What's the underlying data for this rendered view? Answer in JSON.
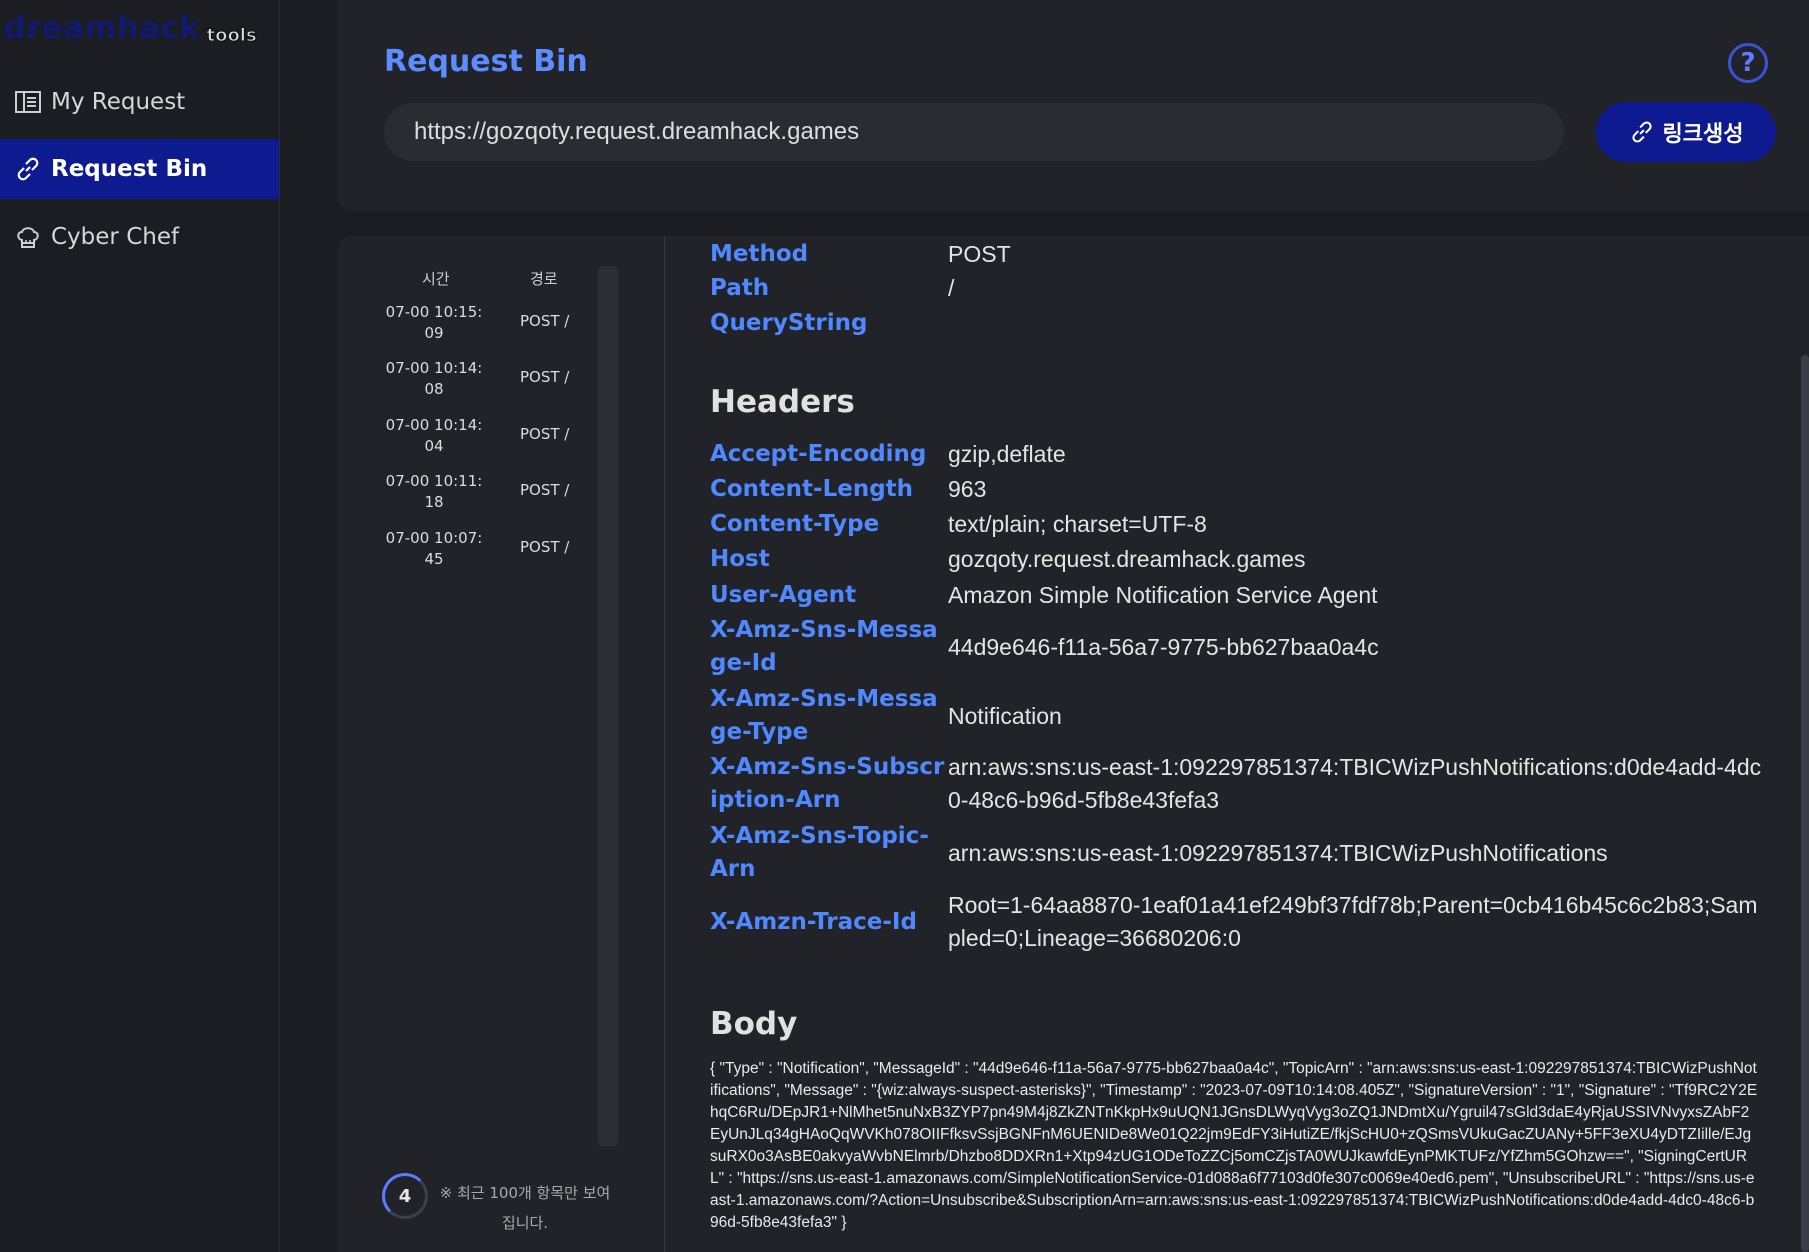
{
  "logo": {
    "brand": "dreamhack",
    "suffix": "tools"
  },
  "sidebar": {
    "items": [
      {
        "label": "My Request",
        "icon": "list-icon",
        "active": false
      },
      {
        "label": "Request Bin",
        "icon": "link-icon",
        "active": true
      },
      {
        "label": "Cyber Chef",
        "icon": "chef-hat-icon",
        "active": false
      }
    ]
  },
  "header": {
    "title": "Request Bin",
    "url": "https://gozqoty.request.dreamhack.games",
    "generate_label": "링크생성",
    "help": "?"
  },
  "list": {
    "col_time": "시간",
    "col_path": "경로",
    "rows": [
      {
        "time": "07-00 10:15:09",
        "path": "POST /"
      },
      {
        "time": "07-00 10:14:08",
        "path": "POST /"
      },
      {
        "time": "07-00 10:14:04",
        "path": "POST /"
      },
      {
        "time": "07-00 10:11:18",
        "path": "POST /"
      },
      {
        "time": "07-00 10:07:45",
        "path": "POST /"
      }
    ],
    "count": "4",
    "note": "※ 최근 100개 항목만 보여집니다."
  },
  "request": {
    "method_label": "Method",
    "method": "POST",
    "path_label": "Path",
    "path": "/",
    "query_label": "QueryString",
    "query": "",
    "headers_title": "Headers",
    "headers": [
      {
        "k": "Accept-Encoding",
        "v": "gzip,deflate"
      },
      {
        "k": "Content-Length",
        "v": "963"
      },
      {
        "k": "Content-Type",
        "v": "text/plain; charset=UTF-8"
      },
      {
        "k": "Host",
        "v": "gozqoty.request.dreamhack.games"
      },
      {
        "k": "User-Agent",
        "v": "Amazon Simple Notification Service Agent"
      },
      {
        "k": "X-Amz-Sns-Message-Id",
        "v": "44d9e646-f11a-56a7-9775-bb627baa0a4c"
      },
      {
        "k": "X-Amz-Sns-Message-Type",
        "v": "Notification"
      },
      {
        "k": "X-Amz-Sns-Subscription-Arn",
        "v": "arn:aws:sns:us-east-1:092297851374:TBICWizPushNotifications:d0de4add-4dc0-48c6-b96d-5fb8e43fefa3"
      },
      {
        "k": "X-Amz-Sns-Topic-Arn",
        "v": "arn:aws:sns:us-east-1:092297851374:TBICWizPushNotifications"
      },
      {
        "k": "X-Amzn-Trace-Id",
        "v": "Root=1-64aa8870-1eaf01a41ef249bf37fdf78b;Parent=0cb416b45c6c2b83;Sampled=0;Lineage=36680206:0"
      }
    ],
    "body_title": "Body",
    "body": "{ \"Type\" : \"Notification\", \"MessageId\" : \"44d9e646-f11a-56a7-9775-bb627baa0a4c\", \"TopicArn\" : \"arn:aws:sns:us-east-1:092297851374:TBICWizPushNotifications\", \"Message\" : \"{wiz:always-suspect-asterisks}\", \"Timestamp\" : \"2023-07-09T10:14:08.405Z\", \"SignatureVersion\" : \"1\", \"Signature\" : \"Tf9RC2Y2EhqC6Ru/DEpJR1+NlMhet5nuNxB3ZYP7pn49M4j8ZkZNTnKkpHx9uUQN1JGnsDLWyqVyg3oZQ1JNDmtXu/Ygruil47sGld3daE4yRjaUSSIVNvyxsZAbF2EyUnJLq34gHAoQqWVKh078OIIFfksvSsjBGNFnM6UENIDe8We01Q22jm9EdFY3iHutiZE/fkjScHU0+zQSmsVUkuGacZUANy+5FF3eXU4yDTZIille/EJgsuRX0o3AsBE0akvyaWvbNElmrb/Dhzbo8DDXRn1+Xtp94zUG1ODeToZZCj5omCZjsTA0WUJkawfdEynPMKTUFz/YfZhm5GOhzw==\", \"SigningCertURL\" : \"https://sns.us-east-1.amazonaws.com/SimpleNotificationService-01d088a6f77103d0fe307c0069e40ed6.pem\", \"UnsubscribeURL\" : \"https://sns.us-east-1.amazonaws.com/?Action=Unsubscribe&SubscriptionArn=arn:aws:sns:us-east-1:092297851374:TBICWizPushNotifications:d0de4add-4dc0-48c6-b96d-5fb8e43fefa3\" }"
  },
  "colors": {
    "accent": "#0e1a8f",
    "key": "#4f88ff",
    "title": "#5c8cff"
  }
}
